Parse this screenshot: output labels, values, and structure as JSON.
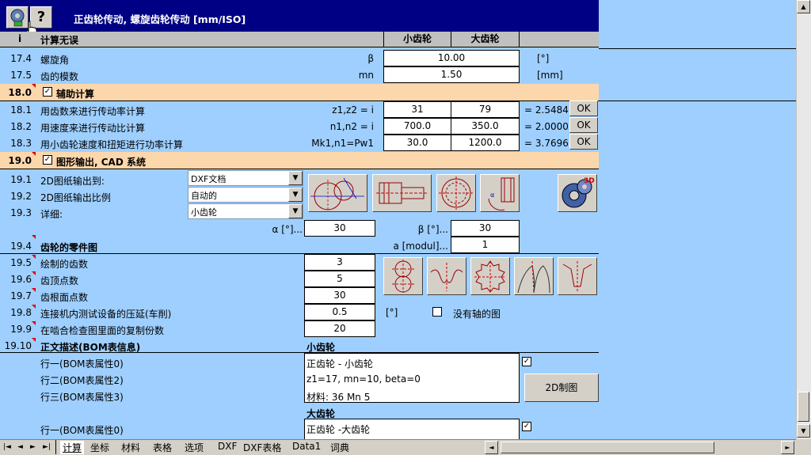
{
  "title": "正齿轮传动, 螺旋齿轮传动 [mm/ISO]",
  "header": {
    "i": "i",
    "status": "计算无误",
    "pinion": "小齿轮",
    "gear": "大齿轮"
  },
  "rows": {
    "r174": {
      "num": "17.4",
      "label": "螺旋角",
      "sym": "β",
      "value": "10.00",
      "unit": "[°]"
    },
    "r175": {
      "num": "17.5",
      "label": "齿的模数",
      "sym": "mn",
      "value": "1.50",
      "unit": "[mm]"
    },
    "s18": {
      "num": "18.0",
      "label": "辅助计算",
      "checked": "✓"
    },
    "r181": {
      "num": "18.1",
      "label": "用齿数来进行传动率计算",
      "sym": "z1,z2 = i",
      "v1": "31",
      "v2": "79",
      "res": "=  2.5484",
      "ok": "OK"
    },
    "r182": {
      "num": "18.2",
      "label": "用速度来进行传动比计算",
      "sym": "n1,n2 = i",
      "v1": "700.0",
      "v2": "350.0",
      "res": "=  2.0000",
      "ok": "OK"
    },
    "r183": {
      "num": "18.3",
      "label": "用小齿轮速度和扭矩进行功率计算",
      "sym": "Mk1,n1=Pw1",
      "v1": "30.0",
      "v2": "1200.0",
      "res": "=  3.7696",
      "ok": "OK"
    },
    "s19": {
      "num": "19.0",
      "label": "图形输出, CAD 系统",
      "checked": "✓"
    },
    "r191": {
      "num": "19.1",
      "label": "2D图纸输出到:",
      "combo": "DXF文档"
    },
    "r192": {
      "num": "19.2",
      "label": "2D图纸输出比例",
      "combo": "自动的"
    },
    "r193": {
      "num": "19.3",
      "label": "详细:",
      "combo": "小齿轮"
    },
    "angles": {
      "alpha_label": "α [°]...",
      "alpha": "30",
      "beta_label": "β [°]...",
      "beta": "30",
      "a_label": "a [modul]...",
      "a": "1"
    },
    "r194": {
      "num": "19.4",
      "label": "齿轮的零件图"
    },
    "r195": {
      "num": "19.5",
      "label": "绘制的齿数",
      "value": "3"
    },
    "r196": {
      "num": "19.6",
      "label": "齿顶点数",
      "value": "5"
    },
    "r197": {
      "num": "19.7",
      "label": "齿根面点数",
      "value": "30"
    },
    "r198": {
      "num": "19.8",
      "label": "连接机内测试设备的压延(车削)",
      "value": "0.5",
      "unit": "[°]",
      "check_label": "没有轴的图"
    },
    "r199": {
      "num": "19.9",
      "label": "在啮合检查图里面的复制份数",
      "value": "20"
    },
    "r1910": {
      "num": "19.10",
      "label": "正文描述(BOM表信息)",
      "pinion": "小齿轮",
      "gear": "大齿轮"
    },
    "bom": {
      "line0": "行一(BOM表属性0)",
      "line1": "行二(BOM表属性2)",
      "line2": "行三(BOM表属性3)",
      "line3": "行一(BOM表属性0)",
      "p0": "正齿轮 - 小齿轮",
      "p1": "z1=17, mn=10, beta=0",
      "p2": "材料: 36 Mn 5",
      "g0": "正齿轮 -大齿轮",
      "check": "✓",
      "button": "2D制图"
    }
  },
  "tabs": [
    "计算",
    "坐标",
    "材料",
    "表格",
    "选项",
    "DXF",
    "DXF表格",
    "Data1",
    "词典"
  ],
  "tab_nav": [
    "|◄",
    "◄",
    "►",
    "►|"
  ],
  "icons": {
    "help": "?",
    "scroll_up": "▲",
    "scroll_down": "▼",
    "scroll_left": "◄",
    "scroll_right": "►",
    "drop": "▼",
    "threed": "3D"
  }
}
